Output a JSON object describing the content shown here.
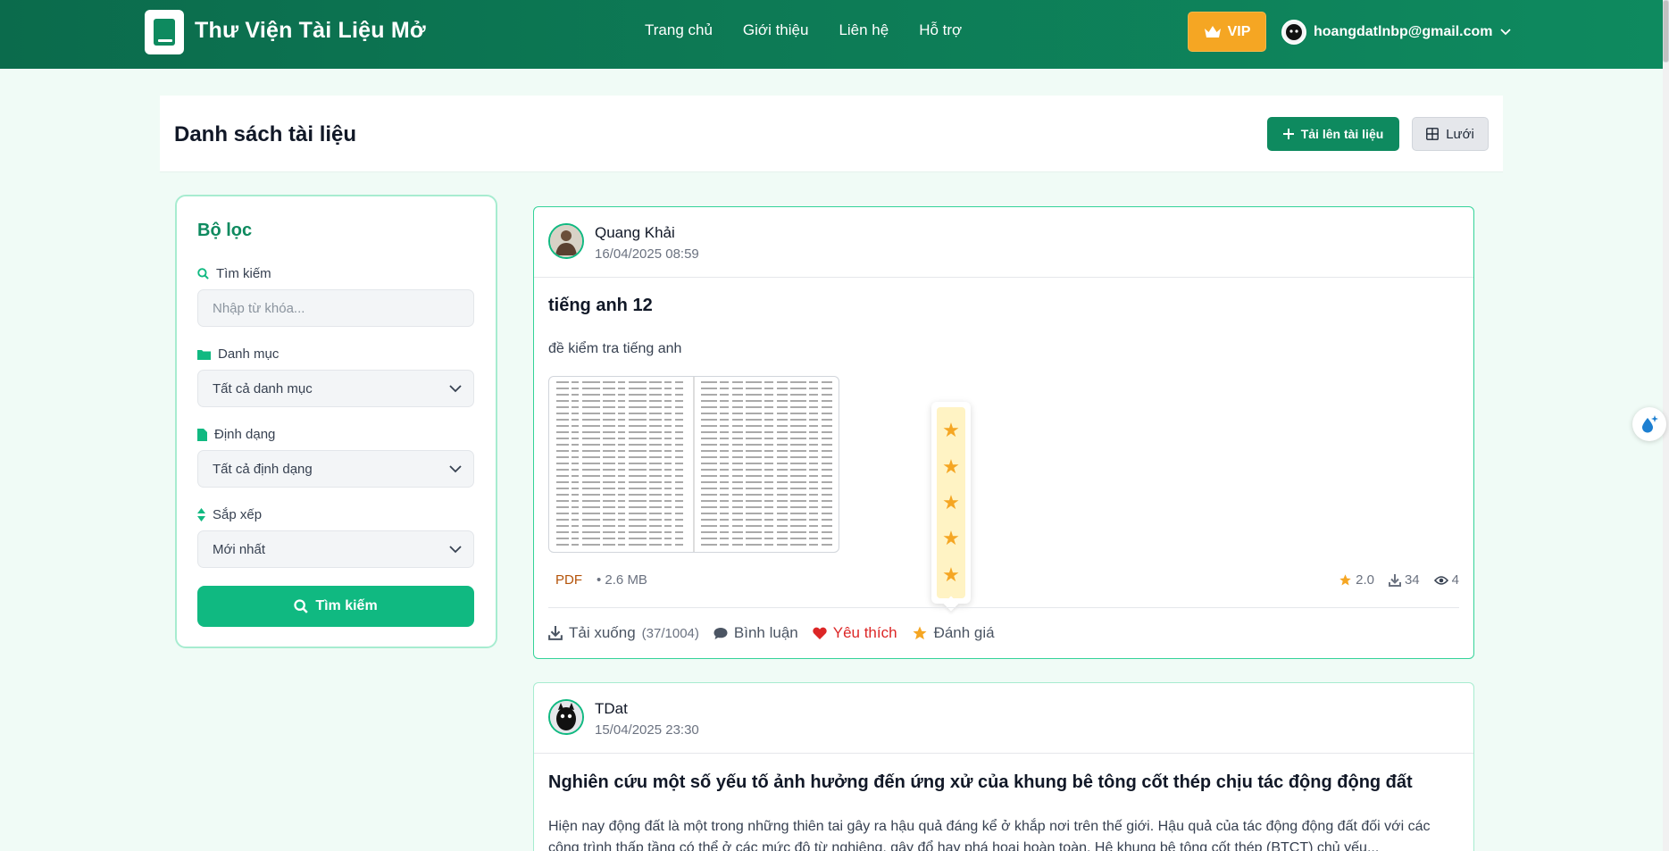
{
  "header": {
    "brand": "Thư Viện Tài Liệu Mở",
    "nav": [
      "Trang chủ",
      "Giới thiệu",
      "Liên hệ",
      "Hỗ trợ"
    ],
    "vip_label": "VIP",
    "user_email": "hoangdatlnbp@gmail.com"
  },
  "page": {
    "title": "Danh sách tài liệu",
    "upload_label": "Tải lên tài liệu",
    "view_label": "Lưới"
  },
  "filter": {
    "title": "Bộ lọc",
    "search_label": "Tìm kiếm",
    "search_placeholder": "Nhập từ khóa...",
    "category_label": "Danh mục",
    "category_value": "Tất cả danh mục",
    "format_label": "Định dạng",
    "format_value": "Tất cả định dạng",
    "sort_label": "Sắp xếp",
    "sort_value": "Mới nhất",
    "submit_label": "Tìm kiếm"
  },
  "documents": [
    {
      "author": "Quang Khải",
      "date": "16/04/2025 08:59",
      "title": "tiếng anh 12",
      "description": "đề kiểm tra tiếng anh",
      "format": "PDF",
      "size": "• 2.6 MB",
      "rating": "2.0",
      "downloads": "34",
      "views": "4",
      "download_label": "Tải xuống",
      "download_quota": "(37/1004)",
      "comment_label": "Bình luận",
      "favorite_label": "Yêu thích",
      "rate_label": "Đánh giá",
      "rating_stars": 5
    },
    {
      "author": "TDat",
      "date": "15/04/2025 23:30",
      "title": "Nghiên cứu một số yếu tố ảnh hưởng đến ứng xử của khung bê tông cốt thép chịu tác động động đất",
      "description": "Hiện nay động đất là một trong những thiên tai gây ra hậu quả đáng kể ở khắp nơi trên thế giới. Hậu quả của tác động động đất đối với các công trình thấp tầng có thể ở các mức độ từ nghiêng, gây đổ hay phá hoại hoàn toàn. Hệ khung bê tông cốt thép (BTCT) chủ yếu..."
    }
  ],
  "colors": {
    "primary": "#0e8a5f",
    "accent": "#10b981",
    "vip": "#f5a623",
    "favorite": "#dc2626"
  }
}
